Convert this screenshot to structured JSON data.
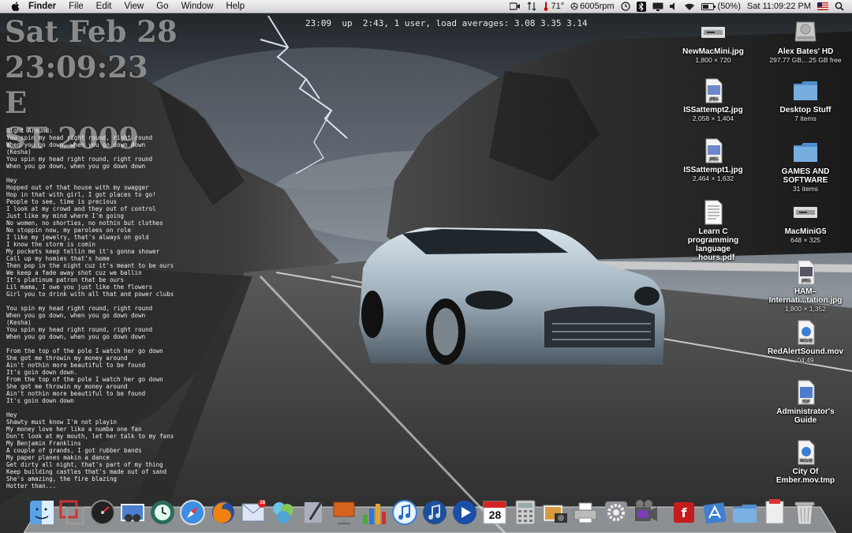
{
  "menubar": {
    "apple_icon": "apple-icon",
    "menus": [
      "Finder",
      "File",
      "Edit",
      "View",
      "Go",
      "Window",
      "Help"
    ],
    "status": {
      "temperature": "71°",
      "fan": "6005rpm",
      "battery": "(50%)",
      "clock": "Sat 11:09:22 PM"
    }
  },
  "clock_overlay": {
    "line1": "Sat Feb 28",
    "line2": "23:09:23 E",
    "line3": "ST 2009"
  },
  "uptime": "23:09  up  2:43, 1 user, load averages: 3.08 3.35 3.14",
  "lyrics": [
    "Right Around:",
    "You spin my head right round, right round",
    "When you go down, when you go down down",
    "(Kesha)",
    "You spin my head right round, right round",
    "When you go down, when you go down down",
    "",
    "Hey",
    "Hopped out of that house with my swagger",
    "Hop in that with girl, I got places to go!",
    "People to see, time is precious",
    "I look at my crowd and they out of control",
    "Just like my mind where I'm going",
    "No women, no shorties, no nothin but clothes",
    "No stoppin now, my parolees on role",
    "I like my jewelry, that's always on gold",
    "I know the storm is comin",
    "My pockets keep tellin me it's gonna shower",
    "Call up my homies that's home",
    "Then pop in the night cuz it's meant to be ours",
    "We keep a fade away shot cuz we ballin",
    "It's platinum patron that be ours",
    "Lil mama, I owe you just like the flowers",
    "Girl you to drink with all that and power clubs",
    "",
    "You spin my head right round, right round",
    "When you go down, when you go down down",
    "(Kesha)",
    "You spin my head right round, right round",
    "When you go down, when you go down down",
    "",
    "From the top of the pole I watch her go down",
    "She got me throwin my money around",
    "Ain't nothin more beautiful to be found",
    "It's goin down down.",
    "From the top of the pole I watch her go down",
    "She got me throwin my money around",
    "Ain't nothin more beautiful to be found",
    "It's goin down down",
    "",
    "Hey",
    "Shawty must know I'm not playin",
    "My money love her like a numba one fan",
    "Don't look at my mouth, let her talk to my fans",
    "My Benjamin Franklins",
    "A couple of grands, I got rubber bands",
    "My paper planes makin a dance",
    "Get dirty all night, that's part of my thing",
    "Keep building castles that's made out of sand",
    "She's amazing, the fire blazing",
    "Hotter than..."
  ],
  "desktop_icons": [
    {
      "name": "NewMacMini.jpg",
      "info": "1,800 × 720",
      "icon": "image-file-icon"
    },
    {
      "name": "Alex Bates' HD",
      "info": "297.77 GB,...25 GB free",
      "icon": "hard-drive-icon"
    },
    {
      "name": "ISSattempt2.jpg",
      "info": "2,058 × 1,404",
      "icon": "jpeg-file-icon"
    },
    {
      "name": "Desktop Stuff",
      "info": "7 items",
      "icon": "folder-icon"
    },
    {
      "name": "ISSattempt1.jpg",
      "info": "2,464 × 1,632",
      "icon": "jpeg-file-icon"
    },
    {
      "name": "GAMES AND SOFTWARE",
      "info": "31 items",
      "icon": "folder-icon"
    },
    {
      "name": "Learn C programming language ...hours.pdf",
      "info": "",
      "icon": "pdf-file-icon"
    },
    {
      "name": "MacMiniG5",
      "info": "648 × 325",
      "icon": "image-file-icon"
    },
    {
      "name": "HAM–Internati...tation.jpg",
      "info": "1,800 × 1,352",
      "icon": "jpeg-file-icon"
    },
    {
      "name": "RedAlertSound.mov",
      "info": "04:49",
      "icon": "movie-file-icon"
    },
    {
      "name": "Administrator's Guide",
      "info": "",
      "icon": "pdf-file-icon"
    },
    {
      "name": "City Of Ember.mov.tmp",
      "info": "",
      "icon": "movie-file-icon"
    }
  ],
  "dock": {
    "calendar_date": "28",
    "mail_badge": "18",
    "items": [
      {
        "app": "Finder",
        "icon": "finder-icon"
      },
      {
        "app": "Parallels",
        "icon": "parallels-icon"
      },
      {
        "app": "Dashboard",
        "icon": "dashboard-icon"
      },
      {
        "app": "Preview",
        "icon": "preview-icon"
      },
      {
        "app": "Time Machine",
        "icon": "time-machine-icon"
      },
      {
        "app": "Safari",
        "icon": "safari-icon"
      },
      {
        "app": "Firefox",
        "icon": "firefox-icon"
      },
      {
        "app": "Mail",
        "icon": "mail-icon"
      },
      {
        "app": "Colloquy",
        "icon": "colloquy-icon"
      },
      {
        "app": "Script Editor",
        "icon": "script-editor-icon"
      },
      {
        "app": "Keynote",
        "icon": "keynote-icon"
      },
      {
        "app": "Numbers",
        "icon": "numbers-icon"
      },
      {
        "app": "iTunes",
        "icon": "itunes-icon"
      },
      {
        "app": "iTunes Helper",
        "icon": "itunes-blue-icon"
      },
      {
        "app": "QuickTime Player",
        "icon": "quicktime-icon"
      },
      {
        "app": "iCal",
        "icon": "ical-icon"
      },
      {
        "app": "Calculator",
        "icon": "calculator-icon"
      },
      {
        "app": "iPhoto",
        "icon": "iphoto-icon"
      },
      {
        "app": "Print Center",
        "icon": "printer-icon"
      },
      {
        "app": "System Preferences",
        "icon": "system-preferences-icon"
      },
      {
        "app": "iMovie",
        "icon": "imovie-icon"
      },
      {
        "app": "Flash",
        "icon": "flash-icon"
      },
      {
        "app": "Applications",
        "icon": "applications-stack-icon"
      },
      {
        "app": "Documents",
        "icon": "folder-stack-icon"
      },
      {
        "app": "Downloads",
        "icon": "downloads-stack-icon"
      },
      {
        "app": "Trash",
        "icon": "trash-icon"
      }
    ]
  },
  "colors": {
    "menubar": "#dcdcdc",
    "clock_text": "#969696",
    "folder_blue": "#5b9bd5",
    "sky": "#3d4550"
  }
}
